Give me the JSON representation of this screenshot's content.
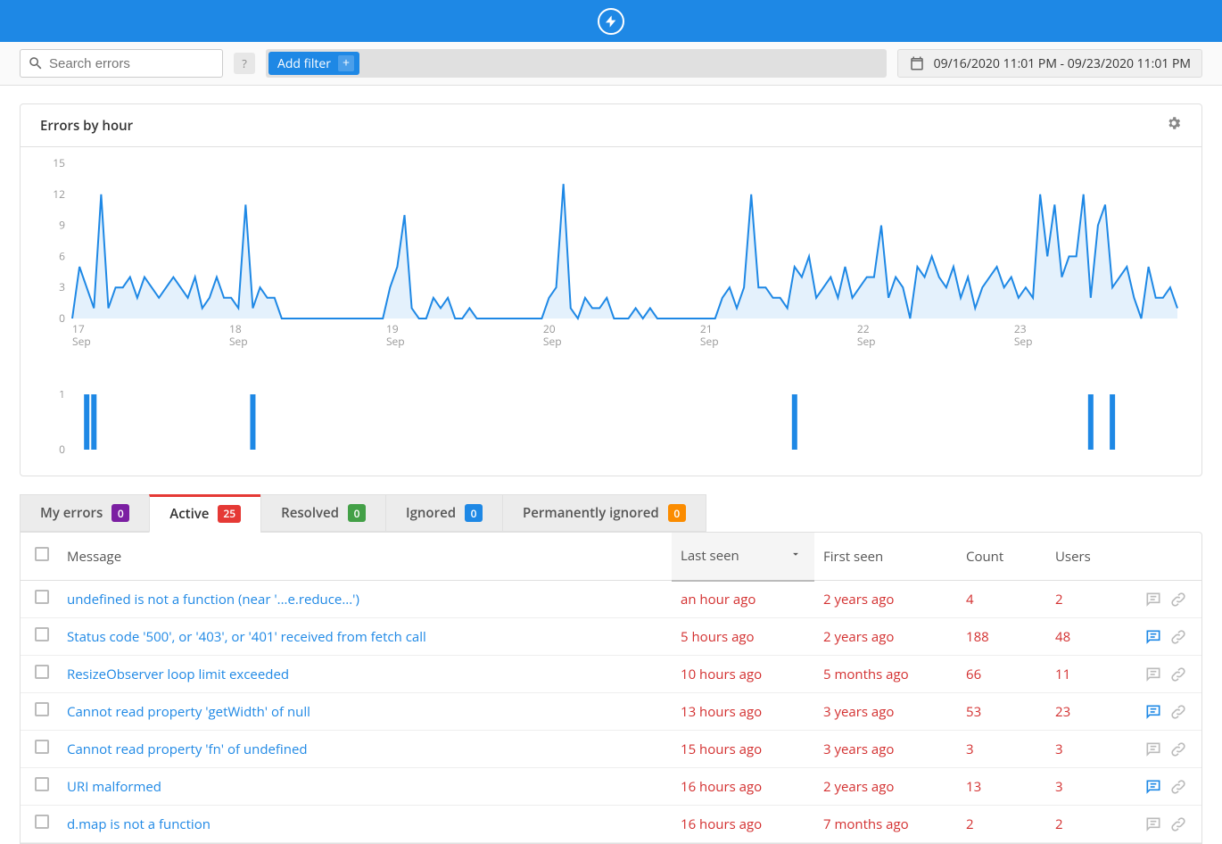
{
  "header": {
    "logo_name": "bolt-icon"
  },
  "toolbar": {
    "search_placeholder": "Search errors",
    "help": "?",
    "add_filter_label": "Add filter",
    "date_range": "09/16/2020 11:01 PM - 09/23/2020 11:01 PM"
  },
  "panel": {
    "title": "Errors by hour"
  },
  "chart_data": {
    "type": "line",
    "title": "Errors by hour",
    "xlabel": "",
    "ylabel": "",
    "ylim": [
      0,
      15
    ],
    "yticks": [
      0,
      3,
      6,
      9,
      12,
      15
    ],
    "x_categories": [
      "17 Sep",
      "18 Sep",
      "19 Sep",
      "20 Sep",
      "21 Sep",
      "22 Sep",
      "23 Sep"
    ],
    "values": [
      0,
      5,
      3,
      1,
      12,
      1,
      3,
      3,
      4,
      2,
      4,
      3,
      2,
      3,
      4,
      3,
      2,
      4,
      1,
      2,
      4,
      2,
      2,
      1,
      11,
      1,
      3,
      2,
      2,
      0,
      0,
      0,
      0,
      0,
      0,
      0,
      0,
      0,
      0,
      0,
      0,
      0,
      0,
      0,
      3,
      5,
      10,
      1,
      0,
      0,
      2,
      1,
      2,
      0,
      0,
      1,
      0,
      0,
      0,
      0,
      0,
      0,
      0,
      0,
      0,
      0,
      2,
      3,
      13,
      1,
      0,
      2,
      1,
      1,
      2,
      0,
      0,
      0,
      1,
      0,
      1,
      0,
      0,
      0,
      0,
      0,
      0,
      0,
      0,
      0,
      2,
      3,
      1,
      3,
      12,
      3,
      3,
      2,
      2,
      1,
      5,
      4,
      6,
      2,
      3,
      4,
      2,
      5,
      2,
      3,
      4,
      4,
      9,
      2,
      4,
      3,
      0,
      5,
      4,
      6,
      4,
      3,
      5,
      2,
      4,
      1,
      3,
      4,
      5,
      3,
      4,
      2,
      3,
      2,
      12,
      6,
      11,
      4,
      6,
      6,
      12,
      2,
      9,
      11,
      3,
      4,
      5,
      2,
      0,
      5,
      2,
      2,
      3,
      1
    ],
    "secondary": {
      "type": "bar",
      "ylim": [
        0,
        1
      ],
      "yticks": [
        0,
        1
      ],
      "values_sparse": [
        {
          "x": 2,
          "v": 1
        },
        {
          "x": 3,
          "v": 1
        },
        {
          "x": 25,
          "v": 1
        },
        {
          "x": 100,
          "v": 1
        },
        {
          "x": 141,
          "v": 1
        },
        {
          "x": 144,
          "v": 1
        }
      ]
    }
  },
  "tabs": [
    {
      "label": "My errors",
      "count": 0,
      "badge_class": "purple",
      "active": false
    },
    {
      "label": "Active",
      "count": 25,
      "badge_class": "red",
      "active": true
    },
    {
      "label": "Resolved",
      "count": 0,
      "badge_class": "green",
      "active": false
    },
    {
      "label": "Ignored",
      "count": 0,
      "badge_class": "blue",
      "active": false
    },
    {
      "label": "Permanently ignored",
      "count": 0,
      "badge_class": "orange",
      "active": false
    }
  ],
  "table": {
    "columns": {
      "message": "Message",
      "last_seen": "Last seen",
      "first_seen": "First seen",
      "count": "Count",
      "users": "Users"
    },
    "rows": [
      {
        "message": "undefined is not a function (near '...e.reduce...')",
        "last_seen": "an hour ago",
        "first_seen": "2 years ago",
        "count": 4,
        "users": 2,
        "has_comment": false
      },
      {
        "message": "Status code '500', or '403', or '401' received from fetch call",
        "last_seen": "5 hours ago",
        "first_seen": "2 years ago",
        "count": 188,
        "users": 48,
        "has_comment": true
      },
      {
        "message": "ResizeObserver loop limit exceeded",
        "last_seen": "10 hours ago",
        "first_seen": "5 months ago",
        "count": 66,
        "users": 11,
        "has_comment": false
      },
      {
        "message": "Cannot read property 'getWidth' of null",
        "last_seen": "13 hours ago",
        "first_seen": "3 years ago",
        "count": 53,
        "users": 23,
        "has_comment": true
      },
      {
        "message": "Cannot read property 'fn' of undefined",
        "last_seen": "15 hours ago",
        "first_seen": "3 years ago",
        "count": 3,
        "users": 3,
        "has_comment": false
      },
      {
        "message": "URI malformed",
        "last_seen": "16 hours ago",
        "first_seen": "2 years ago",
        "count": 13,
        "users": 3,
        "has_comment": true
      },
      {
        "message": "d.map is not a function",
        "last_seen": "16 hours ago",
        "first_seen": "7 months ago",
        "count": 2,
        "users": 2,
        "has_comment": false
      }
    ]
  }
}
